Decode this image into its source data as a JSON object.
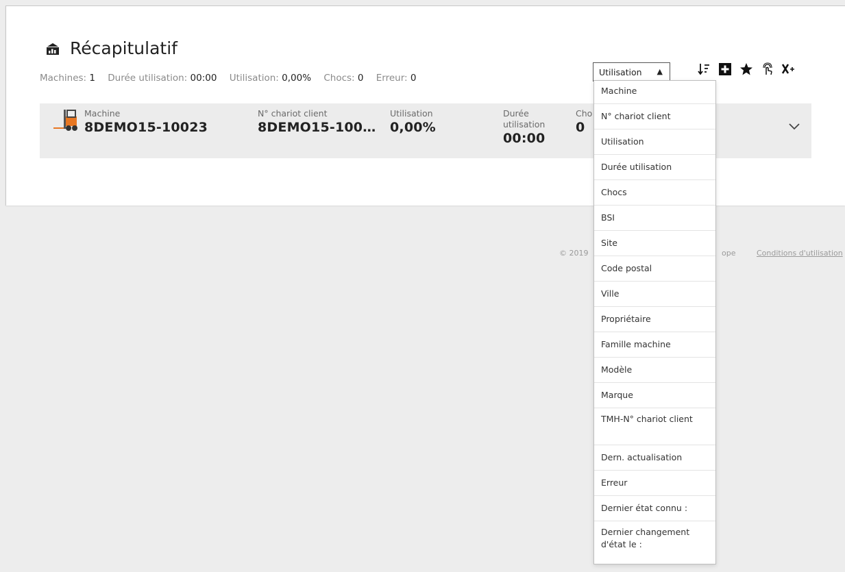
{
  "header": {
    "title": "Récapitulatif"
  },
  "summary": {
    "machines_label": "Machines:",
    "machines_value": "1",
    "duree_label": "Durée utilisation:",
    "duree_value": "00:00",
    "utilisation_label": "Utilisation:",
    "utilisation_value": "0,00%",
    "chocs_label": "Chocs:",
    "chocs_value": "0",
    "erreur_label": "Erreur:",
    "erreur_value": "0"
  },
  "sort_select": {
    "selected": "Utilisation"
  },
  "toolbar": {
    "icons": [
      "sort-icon",
      "add-icon",
      "star-icon",
      "hand-touch-icon",
      "clear-filter-icon"
    ]
  },
  "row": {
    "machine_label": "Machine",
    "machine_value": "8DEMO15-10023",
    "chariot_label": "N° chariot client",
    "chariot_value": "8DEMO15-100…",
    "utilisation_label": "Utilisation",
    "utilisation_value": "0,00%",
    "duree_label_1": "Durée",
    "duree_label_2": "utilisation",
    "duree_value": "00:00",
    "chocs_label": "Cho",
    "chocs_value": "0"
  },
  "footer": {
    "copyright": "© 2019",
    "tail": "ope",
    "terms": "Conditions d'utilisation"
  },
  "dropdown": {
    "options": [
      "Machine",
      "N° chariot client",
      "Utilisation",
      "Durée utilisation",
      "Chocs",
      "BSI",
      "Site",
      "Code postal",
      "Ville",
      "Propriétaire",
      "Famille machine",
      "Modèle",
      "Marque",
      "TMH-N° chariot client",
      "Dern. actualisation",
      "Erreur",
      "Dernier état connu :",
      "Dernier changement d'état le :"
    ]
  },
  "colors": {
    "panel": "#ffffff",
    "background": "#ededed",
    "row": "#ececec"
  }
}
